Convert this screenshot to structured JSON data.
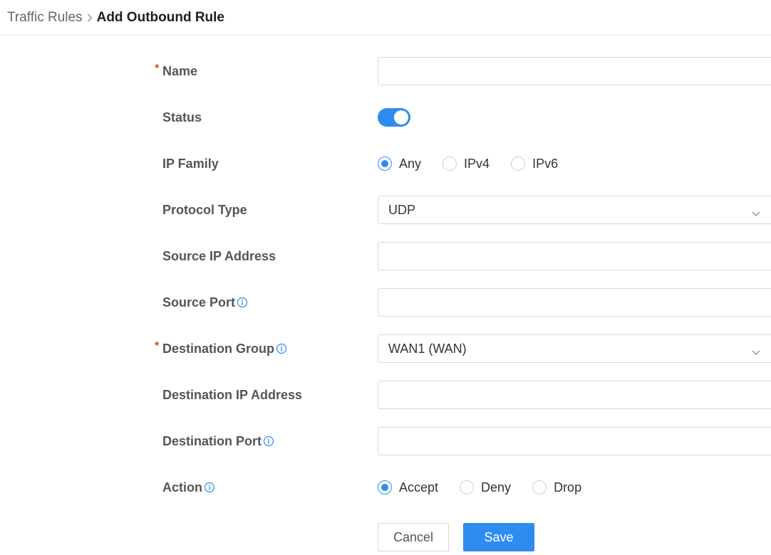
{
  "breadcrumb": {
    "parent": "Traffic Rules",
    "current": "Add Outbound Rule"
  },
  "form": {
    "name": {
      "label": "Name",
      "required_mark": "*",
      "value": ""
    },
    "status": {
      "label": "Status",
      "enabled": true
    },
    "ip_family": {
      "label": "IP Family",
      "options": [
        "Any",
        "IPv4",
        "IPv6"
      ],
      "selected": "Any"
    },
    "protocol_type": {
      "label": "Protocol Type",
      "value": "UDP"
    },
    "source_ip": {
      "label": "Source IP Address",
      "value": ""
    },
    "source_port": {
      "label": "Source Port",
      "value": ""
    },
    "destination_group": {
      "label": "Destination Group",
      "required_mark": "*",
      "value": "WAN1 (WAN)"
    },
    "destination_ip": {
      "label": "Destination IP Address",
      "value": ""
    },
    "destination_port": {
      "label": "Destination Port",
      "value": ""
    },
    "action": {
      "label": "Action",
      "options": [
        "Accept",
        "Deny",
        "Drop"
      ],
      "selected": "Accept"
    }
  },
  "buttons": {
    "cancel": "Cancel",
    "save": "Save"
  },
  "colors": {
    "accent": "#2e8cf0",
    "required": "#e0412f",
    "border": "#d9d9d9"
  },
  "icons": {
    "info": "info-circle-icon",
    "chevron": "chevron-down-icon",
    "breadcrumb_separator": "chevron-right-icon"
  }
}
